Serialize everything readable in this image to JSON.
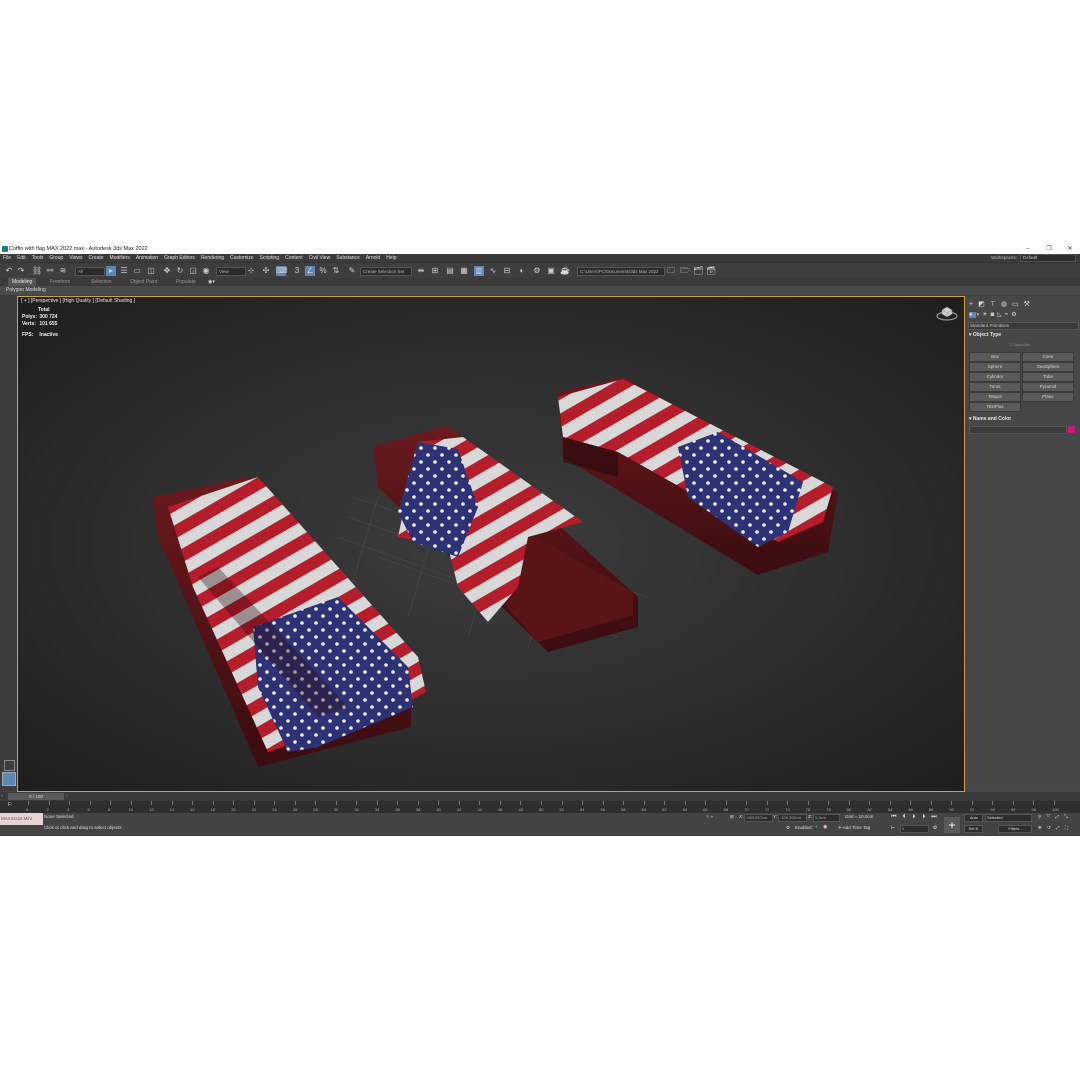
{
  "window": {
    "title": "Coffin with flag MAX 2022.max - Autodesk 3ds Max 2022",
    "minimize": "–",
    "restore": "❐",
    "close": "✕"
  },
  "menu": {
    "items": [
      "File",
      "Edit",
      "Tools",
      "Group",
      "Views",
      "Create",
      "Modifiers",
      "Animation",
      "Graph Editors",
      "Rendering",
      "Customize",
      "Scripting",
      "Content",
      "Civil View",
      "Substance",
      "Arnold",
      "Help"
    ],
    "workspace_label": "Workspaces:",
    "workspace_value": "Default"
  },
  "toolbar": {
    "filter_value": "All",
    "refcoord_value": "View",
    "selection_set_placeholder": "Create Selection Set",
    "path_value": "C:\\Users\\PC\\Documents\\3ds Max 2022",
    "icons": [
      "undo-icon",
      "redo-icon",
      "link-icon",
      "unlink-icon",
      "bind-spacewarp-icon",
      "select-object-icon",
      "select-by-name-icon",
      "rect-selection-icon",
      "window-crossing-icon",
      "select-move-icon",
      "select-rotate-icon",
      "select-scale-icon",
      "select-place-icon",
      "use-pivot-icon",
      "keyboard-shortcut-icon",
      "snap-icon",
      "angle-snap-icon",
      "percent-snap-icon",
      "spinner-snap-icon",
      "edit-named-sel-icon",
      "mirror-icon",
      "align-icon",
      "layer-explorer-icon",
      "toggle-ribbon-icon",
      "curve-editor-icon",
      "schematic-view-icon",
      "material-editor-icon",
      "render-setup-icon",
      "rendered-frame-icon",
      "render-icon",
      "teapot-render-icon",
      "project-folder-icon"
    ]
  },
  "ribbon": {
    "tabs": [
      "Modeling",
      "Freeform",
      "Selection",
      "Object Paint",
      "Populate"
    ],
    "sub_label": "Polygon Modeling"
  },
  "viewport": {
    "label": "[ + ] [Perspective ] [High Quality ] [Default Shading ]",
    "stats": {
      "total_label": "Total",
      "polys_label": "Polys:",
      "polys_value": "300 724",
      "verts_label": "Verts:",
      "verts_value": "101 655",
      "fps_label": "FPS:",
      "fps_value": "Inactive"
    }
  },
  "command_panel": {
    "category": "Standard Primitives",
    "object_type_header": "Object Type",
    "autogrid_label": "AutoGrid",
    "buttons": [
      "Box",
      "Cone",
      "Sphere",
      "GeoSphere",
      "Cylinder",
      "Tube",
      "Torus",
      "Pyramid",
      "Teapot",
      "Plane",
      "TextPlus"
    ],
    "name_color_header": "Name and Color",
    "swatch_color": "#c2197a"
  },
  "timeline": {
    "frame_readout": "0 / 100",
    "ticks": [
      "0",
      "2",
      "4",
      "6",
      "8",
      "10",
      "12",
      "14",
      "16",
      "18",
      "20",
      "22",
      "24",
      "26",
      "28",
      "30",
      "32",
      "34",
      "36",
      "38",
      "40",
      "42",
      "44",
      "46",
      "48",
      "50",
      "52",
      "54",
      "56",
      "58",
      "60",
      "62",
      "64",
      "66",
      "68",
      "70",
      "72",
      "74",
      "76",
      "78",
      "80",
      "82",
      "84",
      "86",
      "88",
      "90",
      "92",
      "94",
      "96",
      "98",
      "100"
    ]
  },
  "status": {
    "maxscript_label": "MAXScript Mini",
    "selection_text": "None Selected",
    "prompt_text": "Click or click and drag to select objects",
    "x_label": "X:",
    "x_value": "-583,957cm",
    "y_label": "Y:",
    "y_value": "-100,392cm",
    "z_label": "Z:",
    "z_value": "0,0cm",
    "grid_text": "Grid = 10,0cm",
    "enabled_label": "Enabled:",
    "add_time_tag": "Add Time Tag",
    "auto_label": "Auto",
    "selected_value": "Selected",
    "setk_label": "Set K.",
    "filters_label": "Filters...",
    "frame_value": "0"
  }
}
